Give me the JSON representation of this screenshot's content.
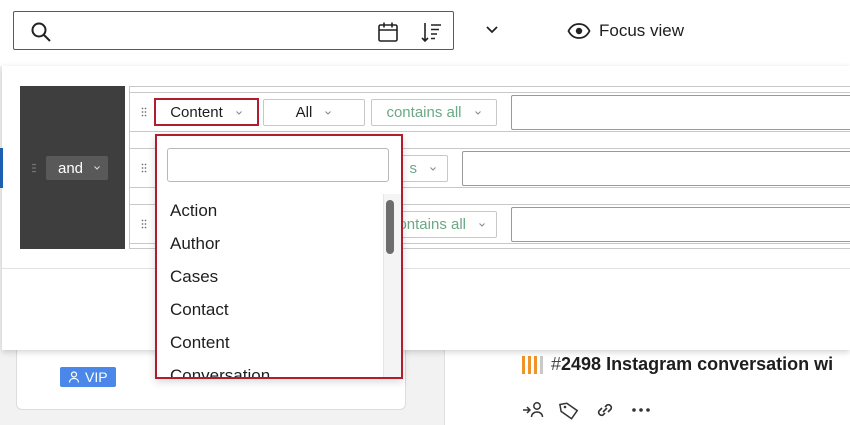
{
  "toolbar": {
    "search_value": "",
    "focus_view_label": "Focus view"
  },
  "filter": {
    "logic_operator": "and",
    "rows": [
      {
        "field": "Content",
        "scope": "All",
        "operator": "contains all",
        "value": ""
      },
      {
        "field": "",
        "scope": "",
        "operator": "s",
        "value": ""
      },
      {
        "field": "",
        "scope": "",
        "operator": "ontains all",
        "value": ""
      }
    ]
  },
  "dropdown": {
    "search_value": "",
    "items": [
      "Action",
      "Author",
      "Cases",
      "Contact",
      "Content",
      "Conversation"
    ]
  },
  "background": {
    "vip_label": "VIP",
    "conversation": {
      "prefix": "#",
      "number": "2498",
      "title": " Instagram conversation wi"
    }
  },
  "colors": {
    "accent_red": "#b01e2e",
    "badge_blue": "#4a87e8",
    "priority_orange": "#f0932a",
    "operator_green": "#6aa985",
    "dark_block": "#3e3e3e"
  }
}
